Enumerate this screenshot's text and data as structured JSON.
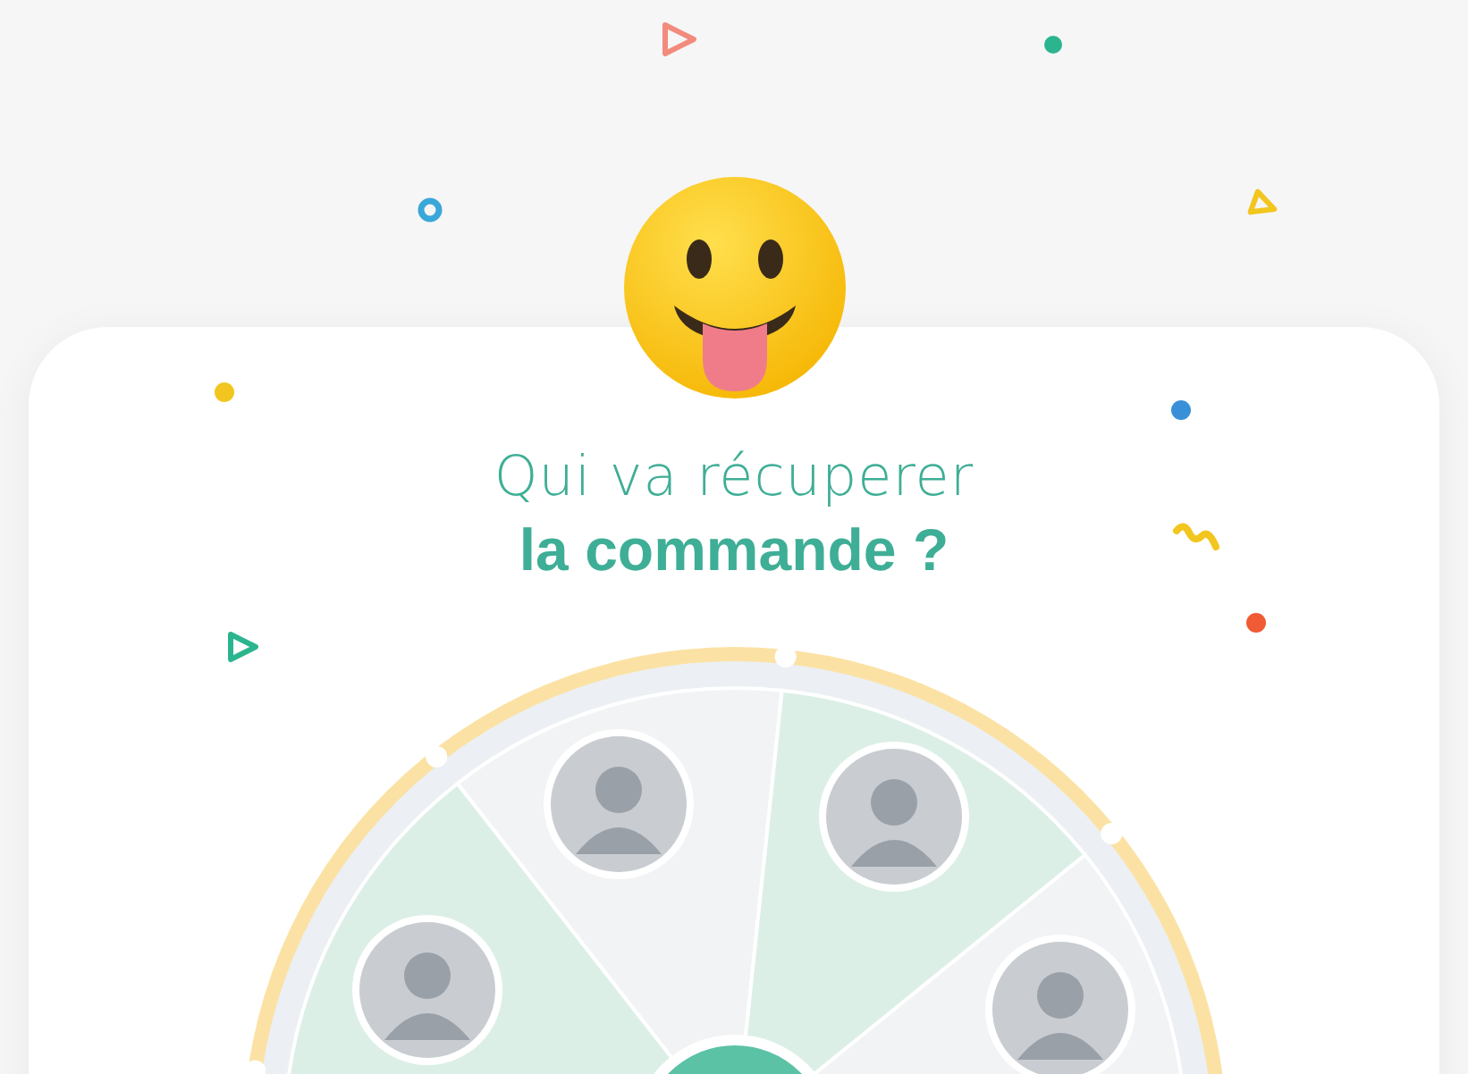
{
  "heading": {
    "line1": "Qui va récuperer",
    "line2": "la commande ?"
  },
  "wheel": {
    "segments": [
      {
        "color": "#dcefe7"
      },
      {
        "color": "#f1f3f5"
      },
      {
        "color": "#dcefe7"
      },
      {
        "color": "#f1f3f5"
      }
    ]
  }
}
